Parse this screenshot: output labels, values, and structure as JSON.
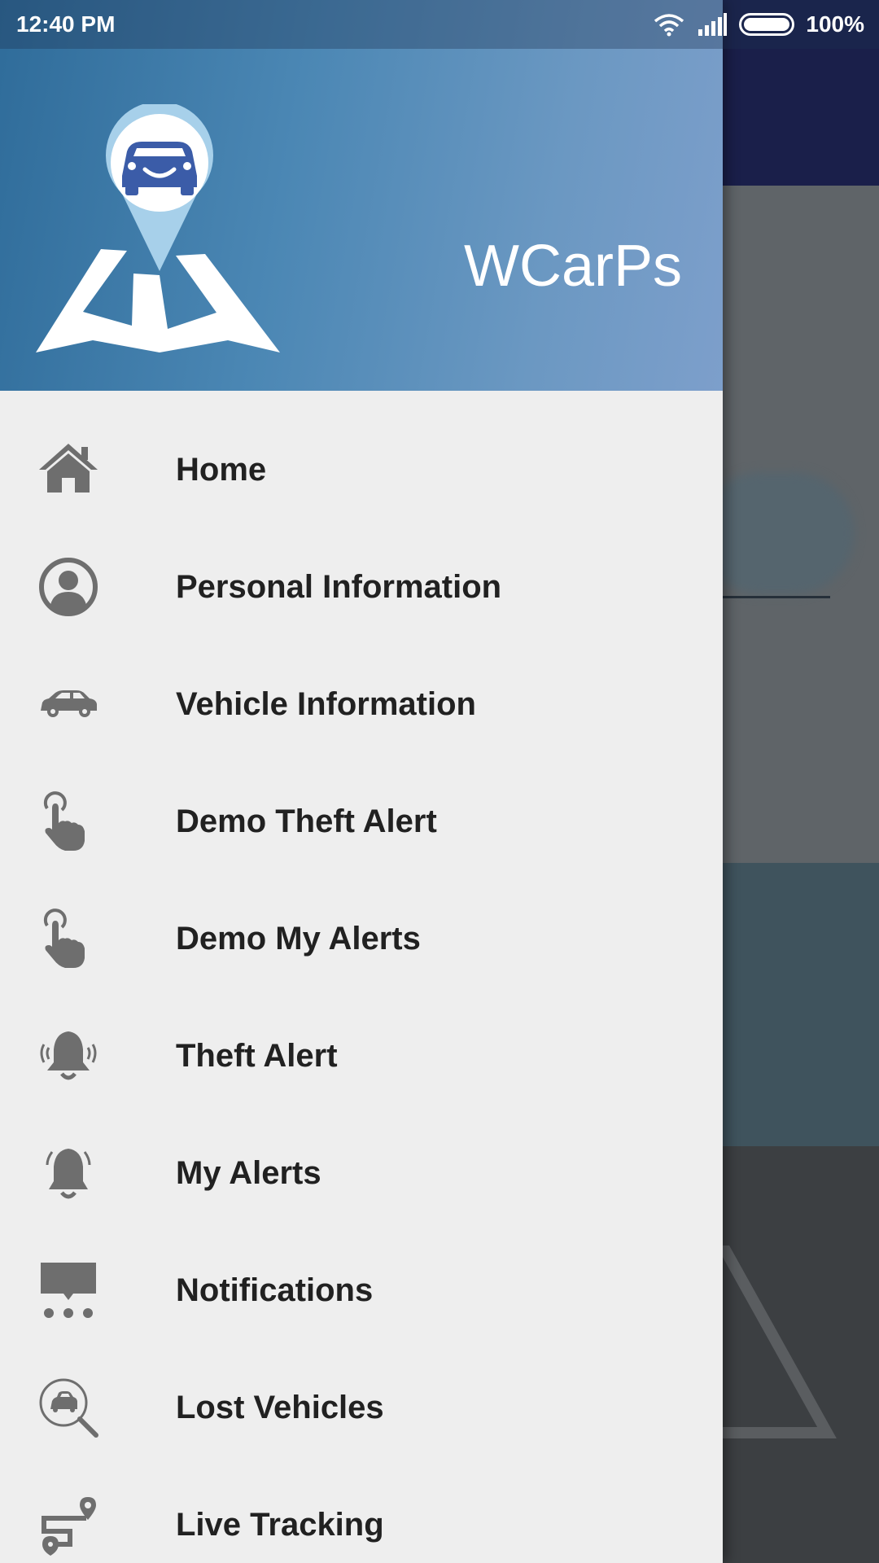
{
  "status_bar": {
    "time": "12:40 PM",
    "battery_percent": "100%",
    "icons": [
      "wifi-icon",
      "signal-icon",
      "battery-icon"
    ]
  },
  "drawer": {
    "app_title": "WCarPs",
    "logo_icon": "location-pin-car-logo",
    "menu_items": [
      {
        "label": "Home",
        "icon": "home-icon"
      },
      {
        "label": "Personal Information",
        "icon": "person-icon"
      },
      {
        "label": "Vehicle Information",
        "icon": "car-icon"
      },
      {
        "label": "Demo Theft Alert",
        "icon": "tap-hand-icon"
      },
      {
        "label": "Demo My Alerts",
        "icon": "tap-hand-icon"
      },
      {
        "label": "Theft Alert",
        "icon": "ringing-bell-icon"
      },
      {
        "label": "My Alerts",
        "icon": "bell-icon"
      },
      {
        "label": "Notifications",
        "icon": "notification-icon"
      },
      {
        "label": "Lost Vehicles",
        "icon": "search-car-icon"
      },
      {
        "label": "Live Tracking",
        "icon": "route-icon"
      }
    ]
  },
  "colors": {
    "header_gradient_start": "#2f6c9a",
    "header_gradient_end": "#7d9fcb",
    "drawer_background": "#eeeeee",
    "icon_gray": "#6e6e6e",
    "label_text": "#212121",
    "logo_blue": "#3b5ca8"
  }
}
